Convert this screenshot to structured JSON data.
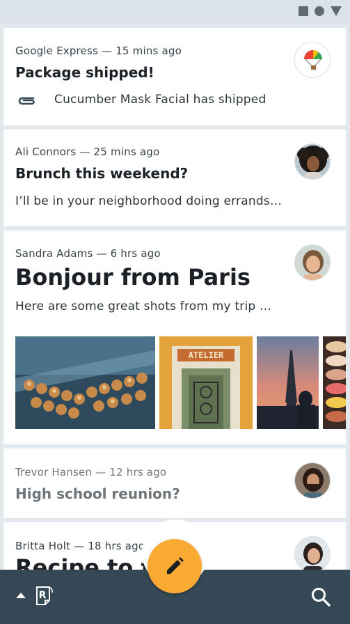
{
  "emails": [
    {
      "sender": "Google Express",
      "time": "15 mins ago",
      "subject": "Package shipped!",
      "preview": "Cucumber Mask Facial has shipped",
      "preview_icon": "attachment-icon",
      "avatar": "google-express-logo"
    },
    {
      "sender": "Ali Connors",
      "time": "25 mins ago",
      "subject": "Brunch this weekend?",
      "preview": "I’ll be in your neighborhood doing errands…",
      "avatar": "ali-connors-photo"
    },
    {
      "sender": "Sandra Adams",
      "time": "6 hrs ago",
      "subject": "Bonjour from Paris",
      "preview": "Here are some great shots from my trip …",
      "avatar": "sandra-adams-photo",
      "sign_text": "ATELIER",
      "photos": [
        "pastries-photo",
        "atelier-door-photo",
        "eiffel-tower-photo",
        "macarons-photo"
      ]
    },
    {
      "sender": "Trevor Hansen",
      "time": "12 hrs ago",
      "subject": "High school reunion?",
      "avatar": "trevor-hansen-photo"
    },
    {
      "sender": "Britta Holt",
      "time": "18 hrs ago",
      "subject": "Recipe to try",
      "avatar": "britta-holt-photo"
    }
  ],
  "meta_separator": " — ",
  "bottom_bar": {
    "menu_icon": "caret-up-icon",
    "logo_icon": "reply-logo-icon",
    "search_icon": "search-icon"
  },
  "fab": {
    "icon": "pencil-icon",
    "label": "Compose"
  },
  "colors": {
    "background": "#e3e8ec",
    "bottom_bar": "#344955",
    "fab": "#f9aa33",
    "text": "#1b2126"
  }
}
